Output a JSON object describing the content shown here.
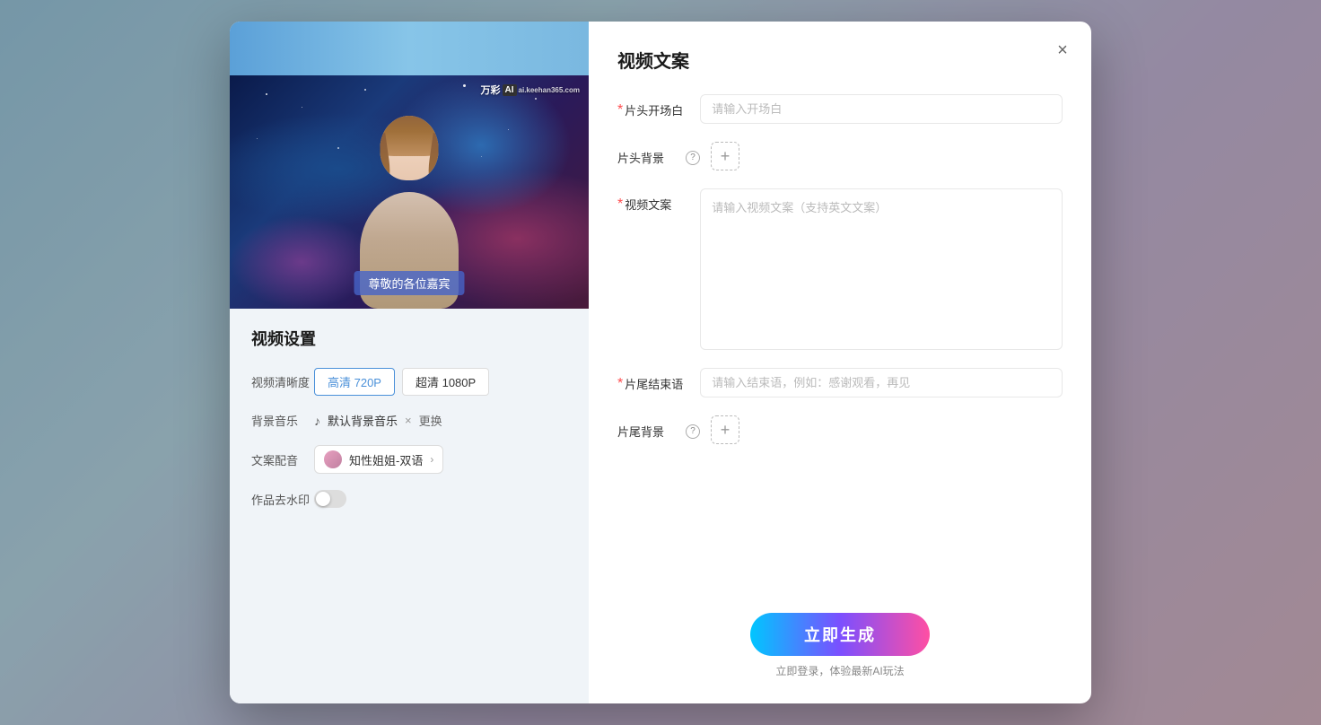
{
  "background": {
    "gradient": "linear-gradient(135deg, #a8d8f0 0%, #c5e8f7 30%, #d4c5e8 60%, #e8c5d4 100%)"
  },
  "modal": {
    "close_label": "×"
  },
  "left_panel": {
    "video_preview": {
      "watermark_brand": "万彩",
      "watermark_ai": "AI",
      "watermark_site": "ai.keehan365.com",
      "subtitle_text": "尊敬的各位嘉宾"
    },
    "settings_title": "视频设置",
    "quality_label": "视频清晰度",
    "quality_options": [
      {
        "label": "高清 720P",
        "active": true
      },
      {
        "label": "超清 1080P",
        "active": false
      }
    ],
    "music_label": "背景音乐",
    "music_name": "默认背景音乐",
    "music_change": "更换",
    "voice_label": "文案配音",
    "voice_name": "知性姐姐-双语",
    "watermark_label": "作品去水印"
  },
  "right_panel": {
    "title": "视频文案",
    "opening_label": "片头开场白",
    "opening_placeholder": "请输入开场白",
    "opening_required": true,
    "header_bg_label": "片头背景",
    "header_bg_required": false,
    "video_copy_label": "视频文案",
    "video_copy_placeholder": "请输入视频文案（支持英文文案）",
    "video_copy_required": true,
    "ending_label": "片尾结束语",
    "ending_placeholder": "请输入结束语，例如：感谢观看，再见",
    "ending_required": true,
    "footer_bg_label": "片尾背景",
    "footer_bg_required": false,
    "generate_btn_label": "立即生成",
    "generate_note": "立即登录，体验最新AI玩法"
  }
}
